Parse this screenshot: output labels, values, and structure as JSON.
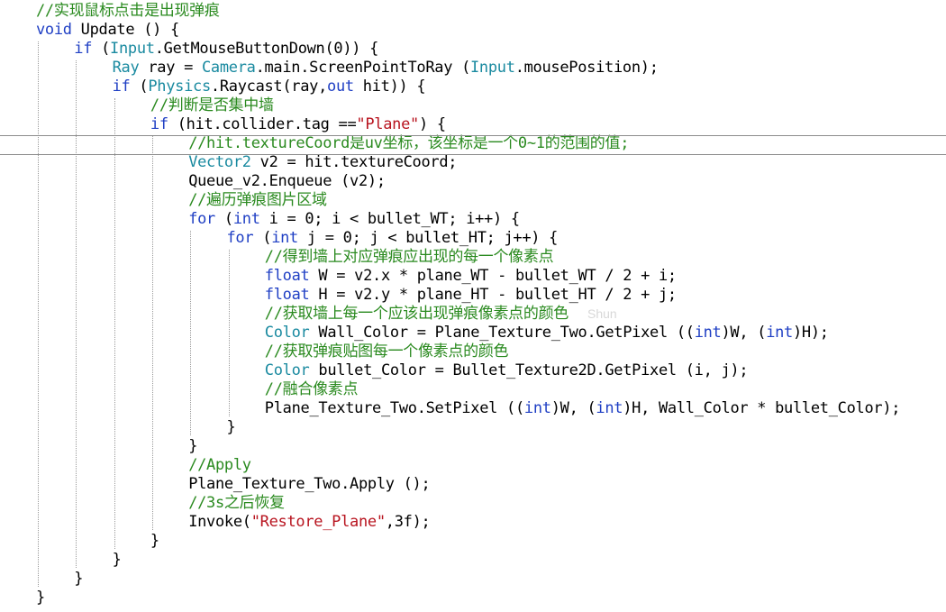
{
  "watermark": "Shun",
  "lines": [
    {
      "indent": 1,
      "tokens": [
        {
          "t": "comment",
          "v": "//实现鼠标点击是出现弹痕"
        }
      ]
    },
    {
      "indent": 1,
      "tokens": [
        {
          "t": "kw",
          "v": "void"
        },
        {
          "t": "plain",
          "v": " Update () {"
        }
      ]
    },
    {
      "indent": 2,
      "tokens": [
        {
          "t": "kw",
          "v": "if"
        },
        {
          "t": "plain",
          "v": " ("
        },
        {
          "t": "type",
          "v": "Input"
        },
        {
          "t": "plain",
          "v": ".GetMouseButtonDown(0)) {"
        }
      ]
    },
    {
      "indent": 3,
      "tokens": [
        {
          "t": "type",
          "v": "Ray"
        },
        {
          "t": "plain",
          "v": " ray = "
        },
        {
          "t": "type",
          "v": "Camera"
        },
        {
          "t": "plain",
          "v": ".main.ScreenPointToRay ("
        },
        {
          "t": "type",
          "v": "Input"
        },
        {
          "t": "plain",
          "v": ".mousePosition);"
        }
      ]
    },
    {
      "indent": 3,
      "tokens": [
        {
          "t": "kw",
          "v": "if"
        },
        {
          "t": "plain",
          "v": " ("
        },
        {
          "t": "type",
          "v": "Physics"
        },
        {
          "t": "plain",
          "v": ".Raycast(ray,"
        },
        {
          "t": "kw",
          "v": "out"
        },
        {
          "t": "plain",
          "v": " hit)) {"
        }
      ]
    },
    {
      "indent": 4,
      "tokens": [
        {
          "t": "comment",
          "v": "//判断是否集中墙"
        }
      ]
    },
    {
      "indent": 4,
      "tokens": [
        {
          "t": "kw",
          "v": "if"
        },
        {
          "t": "plain",
          "v": " (hit.collider.tag =="
        },
        {
          "t": "str",
          "v": "\"Plane\""
        },
        {
          "t": "plain",
          "v": ") {"
        }
      ]
    },
    {
      "indent": 5,
      "tokens": [
        {
          "t": "comment",
          "v": "//hit.textureCoord是uv坐标，该坐标是一个0~1的范围的值;"
        }
      ]
    },
    {
      "indent": 5,
      "tokens": [
        {
          "t": "type",
          "v": "Vector2"
        },
        {
          "t": "plain",
          "v": " v2 = hit.textureCoord;"
        }
      ]
    },
    {
      "indent": 5,
      "tokens": [
        {
          "t": "plain",
          "v": "Queue_v2.Enqueue (v2);"
        }
      ]
    },
    {
      "indent": 5,
      "tokens": [
        {
          "t": "comment",
          "v": "//遍历弹痕图片区域"
        }
      ]
    },
    {
      "indent": 5,
      "tokens": [
        {
          "t": "kw",
          "v": "for"
        },
        {
          "t": "plain",
          "v": " ("
        },
        {
          "t": "kw",
          "v": "int"
        },
        {
          "t": "plain",
          "v": " i = 0; i < bullet_WT; i++) {"
        }
      ]
    },
    {
      "indent": 6,
      "tokens": [
        {
          "t": "kw",
          "v": "for"
        },
        {
          "t": "plain",
          "v": " ("
        },
        {
          "t": "kw",
          "v": "int"
        },
        {
          "t": "plain",
          "v": " j = 0; j < bullet_HT; j++) {"
        }
      ]
    },
    {
      "indent": 7,
      "tokens": [
        {
          "t": "comment",
          "v": "//得到墙上对应弹痕应出现的每一个像素点"
        }
      ]
    },
    {
      "indent": 7,
      "tokens": [
        {
          "t": "kw",
          "v": "float"
        },
        {
          "t": "plain",
          "v": " W = v2.x * plane_WT - bullet_WT / 2 + i;"
        }
      ]
    },
    {
      "indent": 7,
      "tokens": [
        {
          "t": "kw",
          "v": "float"
        },
        {
          "t": "plain",
          "v": " H = v2.y * plane_HT - bullet_HT / 2 + j;"
        }
      ]
    },
    {
      "indent": 7,
      "tokens": [
        {
          "t": "comment",
          "v": "//获取墙上每一个应该出现弹痕像素点的颜色"
        }
      ]
    },
    {
      "indent": 7,
      "tokens": [
        {
          "t": "type",
          "v": "Color"
        },
        {
          "t": "plain",
          "v": " Wall_Color = Plane_Texture_Two.GetPixel (("
        },
        {
          "t": "kw",
          "v": "int"
        },
        {
          "t": "plain",
          "v": ")W, ("
        },
        {
          "t": "kw",
          "v": "int"
        },
        {
          "t": "plain",
          "v": ")H);"
        }
      ]
    },
    {
      "indent": 7,
      "tokens": [
        {
          "t": "comment",
          "v": "//获取弹痕贴图每一个像素点的颜色"
        }
      ]
    },
    {
      "indent": 7,
      "tokens": [
        {
          "t": "type",
          "v": "Color"
        },
        {
          "t": "plain",
          "v": " bullet_Color = Bullet_Texture2D.GetPixel (i, j);"
        }
      ]
    },
    {
      "indent": 7,
      "tokens": [
        {
          "t": "comment",
          "v": "//融合像素点"
        }
      ]
    },
    {
      "indent": 7,
      "tokens": [
        {
          "t": "plain",
          "v": "Plane_Texture_Two.SetPixel (("
        },
        {
          "t": "kw",
          "v": "int"
        },
        {
          "t": "plain",
          "v": ")W, ("
        },
        {
          "t": "kw",
          "v": "int"
        },
        {
          "t": "plain",
          "v": ")H, Wall_Color * bullet_Color);"
        }
      ]
    },
    {
      "indent": 6,
      "tokens": [
        {
          "t": "plain",
          "v": "}"
        }
      ]
    },
    {
      "indent": 5,
      "tokens": [
        {
          "t": "plain",
          "v": "}"
        }
      ]
    },
    {
      "indent": 5,
      "tokens": [
        {
          "t": "comment",
          "v": "//Apply"
        }
      ]
    },
    {
      "indent": 5,
      "tokens": [
        {
          "t": "plain",
          "v": "Plane_Texture_Two.Apply ();"
        }
      ]
    },
    {
      "indent": 5,
      "tokens": [
        {
          "t": "comment",
          "v": "//3s之后恢复"
        }
      ]
    },
    {
      "indent": 5,
      "tokens": [
        {
          "t": "plain",
          "v": "Invoke("
        },
        {
          "t": "str",
          "v": "\"Restore_Plane\""
        },
        {
          "t": "plain",
          "v": ",3f);"
        }
      ]
    },
    {
      "indent": 4,
      "tokens": [
        {
          "t": "plain",
          "v": "}"
        }
      ]
    },
    {
      "indent": 3,
      "tokens": [
        {
          "t": "plain",
          "v": "}"
        }
      ]
    },
    {
      "indent": 2,
      "tokens": [
        {
          "t": "plain",
          "v": "}"
        }
      ]
    },
    {
      "indent": 0,
      "tokens": [
        {
          "t": "plain",
          "v": "}"
        }
      ]
    }
  ],
  "colors": {
    "comment": "#2a8a1f",
    "keyword": "#1f3fc4",
    "type": "#1a8aa0",
    "string": "#b8141f",
    "plain": "#000000"
  }
}
